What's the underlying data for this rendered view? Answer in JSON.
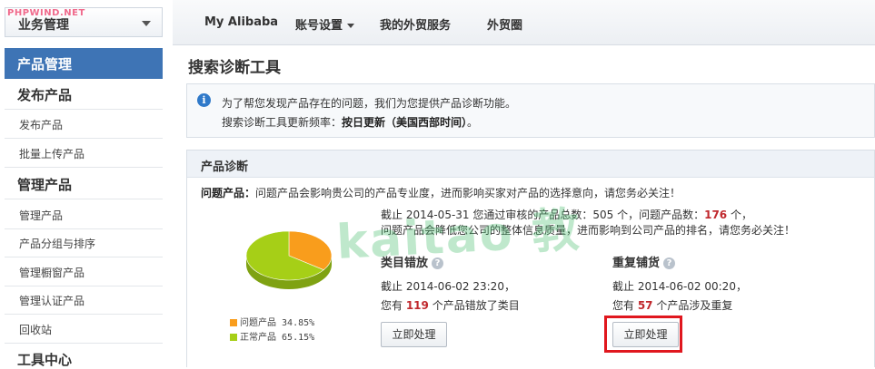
{
  "watermark": {
    "text": "PHPWIND.NET",
    "center_text": "kaitao 教"
  },
  "biz_select": {
    "label": "业务管理"
  },
  "topnav": {
    "items": [
      "My Alibaba",
      "账号设置",
      "我的外贸服务",
      "外贸圈"
    ]
  },
  "sidebar": {
    "active": "产品管理",
    "groups": [
      {
        "title": "发布产品",
        "items": [
          "发布产品",
          "批量上传产品"
        ]
      },
      {
        "title": "管理产品",
        "items": [
          "管理产品",
          "产品分组与排序",
          "管理橱窗产品",
          "管理认证产品",
          "回收站"
        ]
      },
      {
        "title": "工具中心",
        "items": []
      }
    ]
  },
  "page": {
    "title": "搜索诊断工具"
  },
  "info": {
    "line1": "为了帮您发现产品存在的问题，我们为您提供产品诊断功能。",
    "line2_prefix": "搜索诊断工具更新频率：",
    "line2_bold": "按日更新（美国西部时间）",
    "line2_suffix": "。"
  },
  "diagnosis": {
    "header": "产品诊断",
    "problem_label": "问题产品：",
    "problem_text": "问题产品会影响贵公司的产品专业度，进而影响买家对产品的选择意向，请您务必关注！",
    "stat_prefix": "截止 2014-05-31 您通过审核的产品总数：",
    "stat_total": "505",
    "stat_mid": " 个，问题产品数：",
    "stat_problem": "176",
    "stat_suffix": " 个，",
    "stat_line2": "问题产品会降低您公司的整体信息质量，进而影响到公司产品的排名，请您务必关注！",
    "legend": [
      {
        "label": "问题产品",
        "value": "34.85%",
        "color": "#f99d1c"
      },
      {
        "label": "正常产品",
        "value": "65.15%",
        "color": "#a6cf17"
      }
    ],
    "sections": [
      {
        "title": "类目错放",
        "date": "截止 2014-06-02 23:20，",
        "count_prefix": "您有 ",
        "count": "119",
        "count_suffix": " 个产品错放了类目",
        "button": "立即处理"
      },
      {
        "title": "重复铺货",
        "date": "截止 2014-06-02 00:20，",
        "count_prefix": "您有 ",
        "count": "57",
        "count_suffix": " 个产品涉及重复",
        "button": "立即处理"
      }
    ]
  },
  "chart_data": {
    "type": "pie",
    "categories": [
      "问题产品",
      "正常产品"
    ],
    "values": [
      34.85,
      65.15
    ],
    "colors": [
      "#f99d1c",
      "#a6cf17"
    ],
    "legend_position": "bottom"
  }
}
